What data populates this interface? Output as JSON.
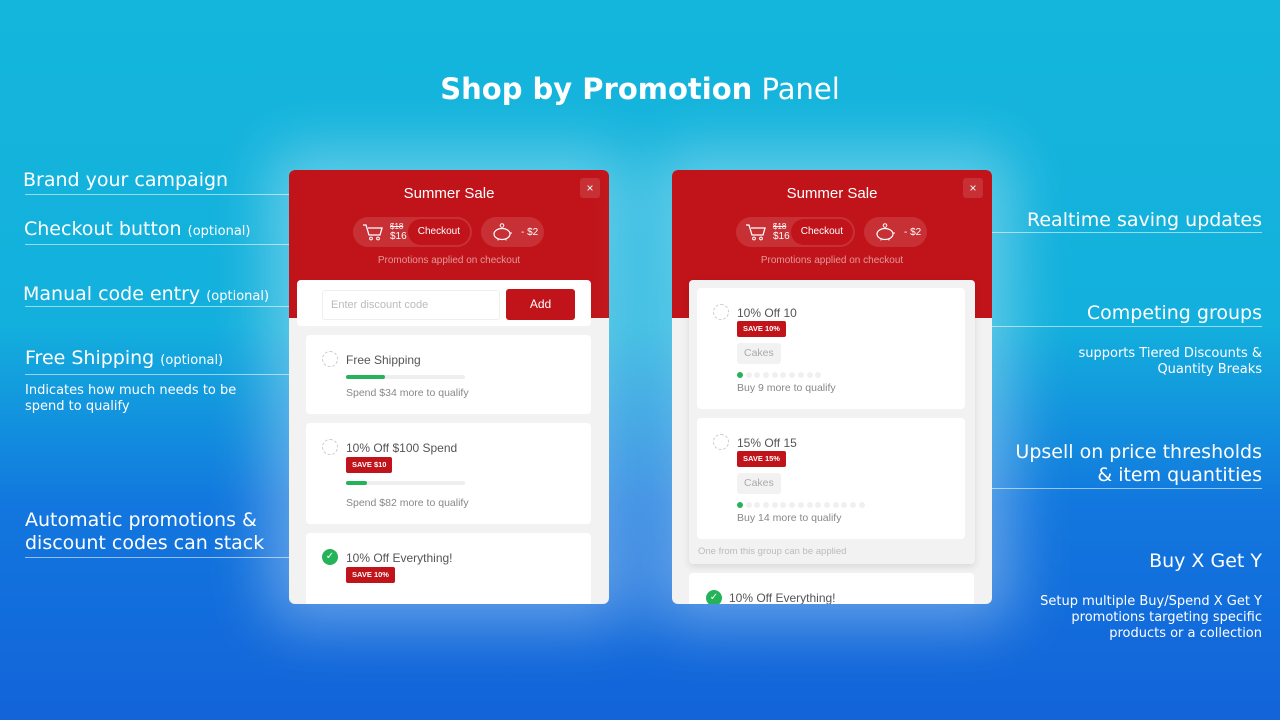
{
  "title": {
    "bold": "Shop by Promotion",
    "rest": "Panel"
  },
  "annotations_left": [
    {
      "text": "Brand your campaign",
      "optional": ""
    },
    {
      "text": "Checkout button",
      "optional": "(optional)"
    },
    {
      "text": "Manual code entry",
      "optional": "(optional)"
    },
    {
      "text": "Free Shipping",
      "optional": "(optional)",
      "sub": "Indicates how much needs to be spend to qualify"
    },
    {
      "text": "Automatic promotions & discount codes can stack"
    }
  ],
  "annotations_right": [
    {
      "text": "Realtime saving updates"
    },
    {
      "text": "Competing groups",
      "sub": "supports Tiered Discounts & Quantity Breaks"
    },
    {
      "text": "Upsell on price thresholds & item quantities"
    },
    {
      "text": "Buy X Get Y",
      "sub": "Setup multiple Buy/Spend X Get Y promotions targeting specific products or a collection"
    }
  ],
  "panel": {
    "title": "Summer Sale",
    "close": "×",
    "original_price": "$18",
    "price": "$16",
    "checkout": "Checkout",
    "saving": "- $2",
    "applied_note": "Promotions applied on checkout",
    "code_placeholder": "Enter discount code",
    "add": "Add"
  },
  "left_promos": [
    {
      "name": "Free Shipping",
      "progress": 0.33,
      "note": "Spend  $34  more to qualify",
      "applied": false
    },
    {
      "name": "10% Off $100 Spend",
      "badge": "SAVE $10",
      "progress": 0.18,
      "note": "Spend  $82  more to qualify",
      "applied": false
    },
    {
      "name": "10% Off Everything!",
      "badge": "SAVE 10%",
      "applied": true
    }
  ],
  "right_group": {
    "items": [
      {
        "name": "10% Off 10",
        "badge": "SAVE 10%",
        "tag": "Cakes",
        "qty_have": 1,
        "qty_total": 10,
        "note": "Buy 9 more to qualify"
      },
      {
        "name": "15% Off 15",
        "badge": "SAVE 15%",
        "tag": "Cakes",
        "qty_have": 1,
        "qty_total": 15,
        "note": "Buy 14 more to qualify"
      }
    ],
    "note": "One from this group can be applied"
  },
  "right_applied": {
    "name": "10% Off Everything!",
    "applied": true
  },
  "colors": {
    "brand_red": "#c0141a",
    "success_green": "#25b35a"
  }
}
